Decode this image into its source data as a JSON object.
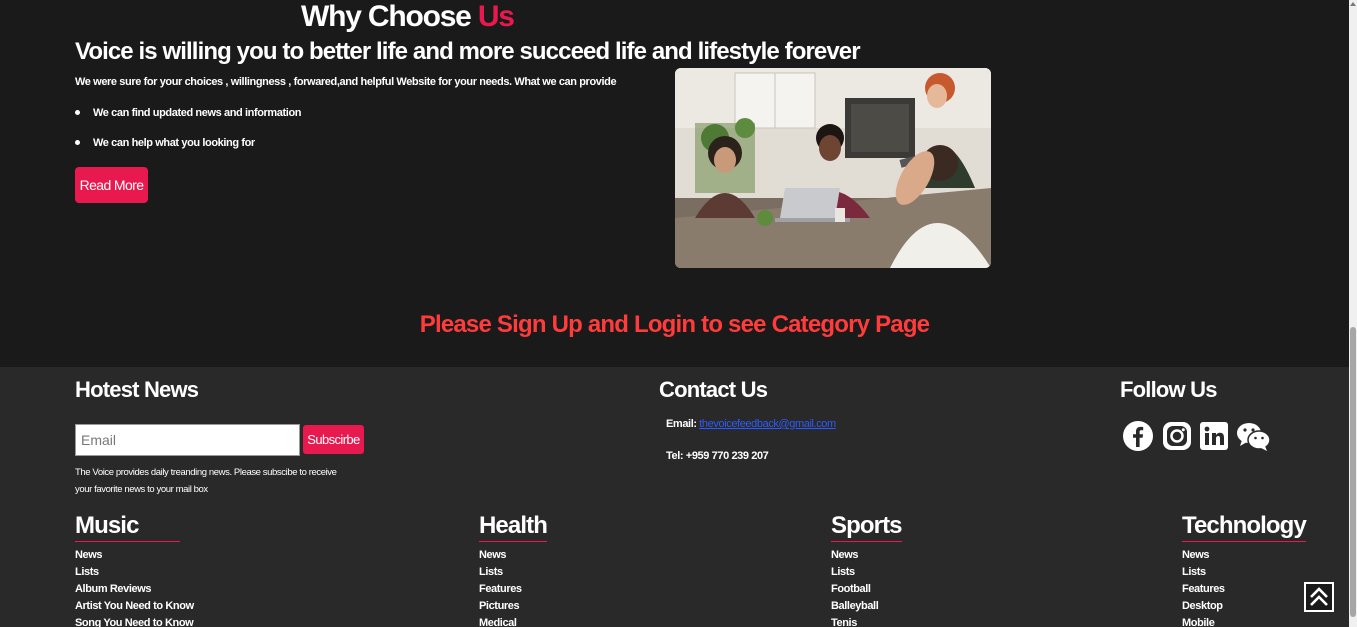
{
  "why": {
    "title_part1": "Why Choose ",
    "title_accent": "Us",
    "subtitle": "Voice is willing you to better life and more succeed life and lifestyle forever",
    "intro": "We were sure for your choices , willingness , forwared,and helpful Website for your needs. What we can provide",
    "bullets": [
      "We can find updated news and information",
      "We can help what you looking for"
    ],
    "read_more": "Read More"
  },
  "signup_message": "Please Sign Up and Login to see Category Page",
  "footer": {
    "hotest_news": {
      "title": "Hotest News",
      "email_placeholder": "Email",
      "subscribe": "Subscirbe",
      "note": "The Voice provides daily treanding news. Please subscibe to receive your favorite news to your mail box"
    },
    "contact": {
      "title": "Contact Us",
      "email_label": "Email: ",
      "email_value": "thevoicefeedback@gmail.com",
      "tel": "Tel: +959 770 239 207"
    },
    "follow": {
      "title": "Follow Us",
      "icons": [
        "facebook-icon",
        "instagram-icon",
        "linkedin-icon",
        "wechat-icon"
      ]
    },
    "categories": [
      {
        "title": "Music",
        "items": [
          "News",
          "Lists",
          "Album Reviews",
          "Artist You Need to Know",
          "Song You Need to Know"
        ]
      },
      {
        "title": "Health",
        "items": [
          "News",
          "Lists",
          "Features",
          "Pictures",
          "Medical"
        ]
      },
      {
        "title": "Sports",
        "items": [
          "News",
          "Lists",
          "Football",
          "Balleyball",
          "Tenis"
        ]
      },
      {
        "title": "Technology",
        "items": [
          "News",
          "Lists",
          "Features",
          "Desktop",
          "Mobile"
        ]
      }
    ]
  },
  "colors": {
    "accent": "#e8194f",
    "signup": "#ff3b3b",
    "background": "#1b1a1b",
    "footer": "#2a292a"
  }
}
